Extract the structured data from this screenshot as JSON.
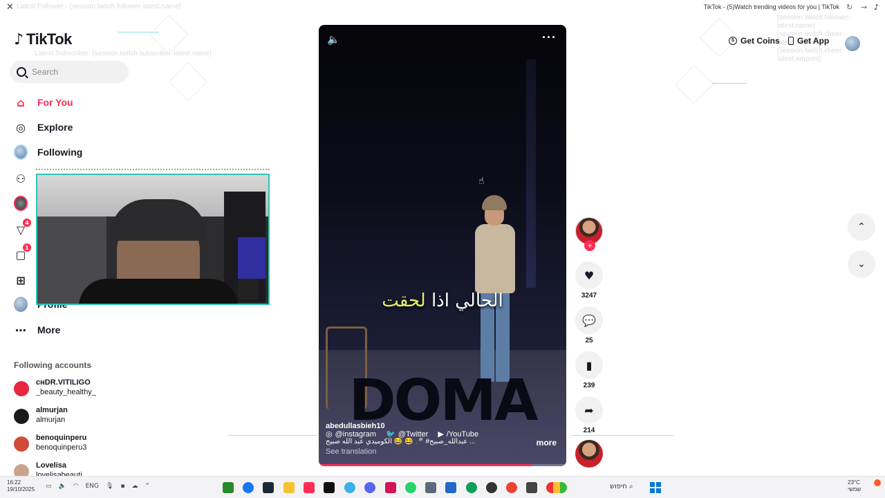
{
  "window": {
    "title": "TikTok - (5)Watch trending videos for you | TikTok",
    "close": "✕",
    "refresh": "↻",
    "forward": "→"
  },
  "overlay": {
    "latest_follower": "Latest Follower - {session.twitch.follower-latest.name}",
    "latest_subscriber": "Latest Subscriber: {session.twitch.subscriber-latest.name}",
    "right_block": "{session.twitch.follower-latest.name} {session.twitch.cheer-latest.name} {session.twitch.cheer-latest.amount}"
  },
  "logo": {
    "glyph": "♪",
    "text": "TikTok"
  },
  "search": {
    "placeholder": "Search"
  },
  "nav": [
    {
      "label": "For You",
      "icon": "home-icon",
      "glyph": "⌂"
    },
    {
      "label": "Explore",
      "icon": "compass-icon",
      "glyph": "◎"
    },
    {
      "label": "Following",
      "icon": "following-avatar-icon",
      "glyph": ""
    },
    {
      "label": "",
      "icon": "friends-icon",
      "glyph": "⚇"
    },
    {
      "label": "",
      "icon": "live-avatar-icon",
      "glyph": ""
    },
    {
      "label": "",
      "icon": "activity-icon",
      "glyph": "▽",
      "badge": "4"
    },
    {
      "label": "",
      "icon": "messages-icon",
      "glyph": "▢",
      "badge": "1"
    },
    {
      "label": "",
      "icon": "upload-icon",
      "glyph": "⊞"
    },
    {
      "label": "Profile",
      "icon": "profile-avatar-icon",
      "glyph": ""
    },
    {
      "label": "More",
      "icon": "more-dots-icon",
      "glyph": "⋯"
    }
  ],
  "following_accounts": {
    "title": "Following accounts",
    "items": [
      {
        "name": "ᴄʜDR.VITILIGO",
        "username": "_beauty_healthy_",
        "color": "#e8263f"
      },
      {
        "name": "almurjan",
        "username": "almurjan",
        "color": "#1b1b1b"
      },
      {
        "name": "benoquinperu",
        "username": "benoquinperu3",
        "color": "#d24a3a"
      },
      {
        "name": "Lovelisa",
        "username": "lovelisabeauti",
        "color": "#c9a48a"
      }
    ]
  },
  "video": {
    "caption_main": "الحالي اذا ",
    "caption_highlight": "لحقت",
    "brand": "DOMA",
    "author": "abedullasbieh10",
    "socials": [
      "@instagram",
      "@Twitter",
      "/YouTube"
    ],
    "description": "عبدالله_صبيح# 🎤 😂 😂 الكوميدي عبد الله صبيح ...",
    "more": "more",
    "translate": "See translation",
    "progress": 0.86
  },
  "actions": {
    "likes": "3247",
    "comments": "25",
    "bookmarks": "239",
    "shares": "214",
    "follow_plus": "+"
  },
  "top_right": {
    "get_coins": "Get Coins",
    "get_app": "Get App"
  },
  "arrows": {
    "up": "⌃",
    "down": "⌄"
  },
  "taskbar": {
    "time": "16:22",
    "date": "19/10/2025",
    "lang": "ENG",
    "search_label": "חיפוש",
    "temp": "23°C",
    "weather_word": "שמשי"
  },
  "colors": {
    "accent": "#fe2c55",
    "teal": "#2ec4b6"
  }
}
